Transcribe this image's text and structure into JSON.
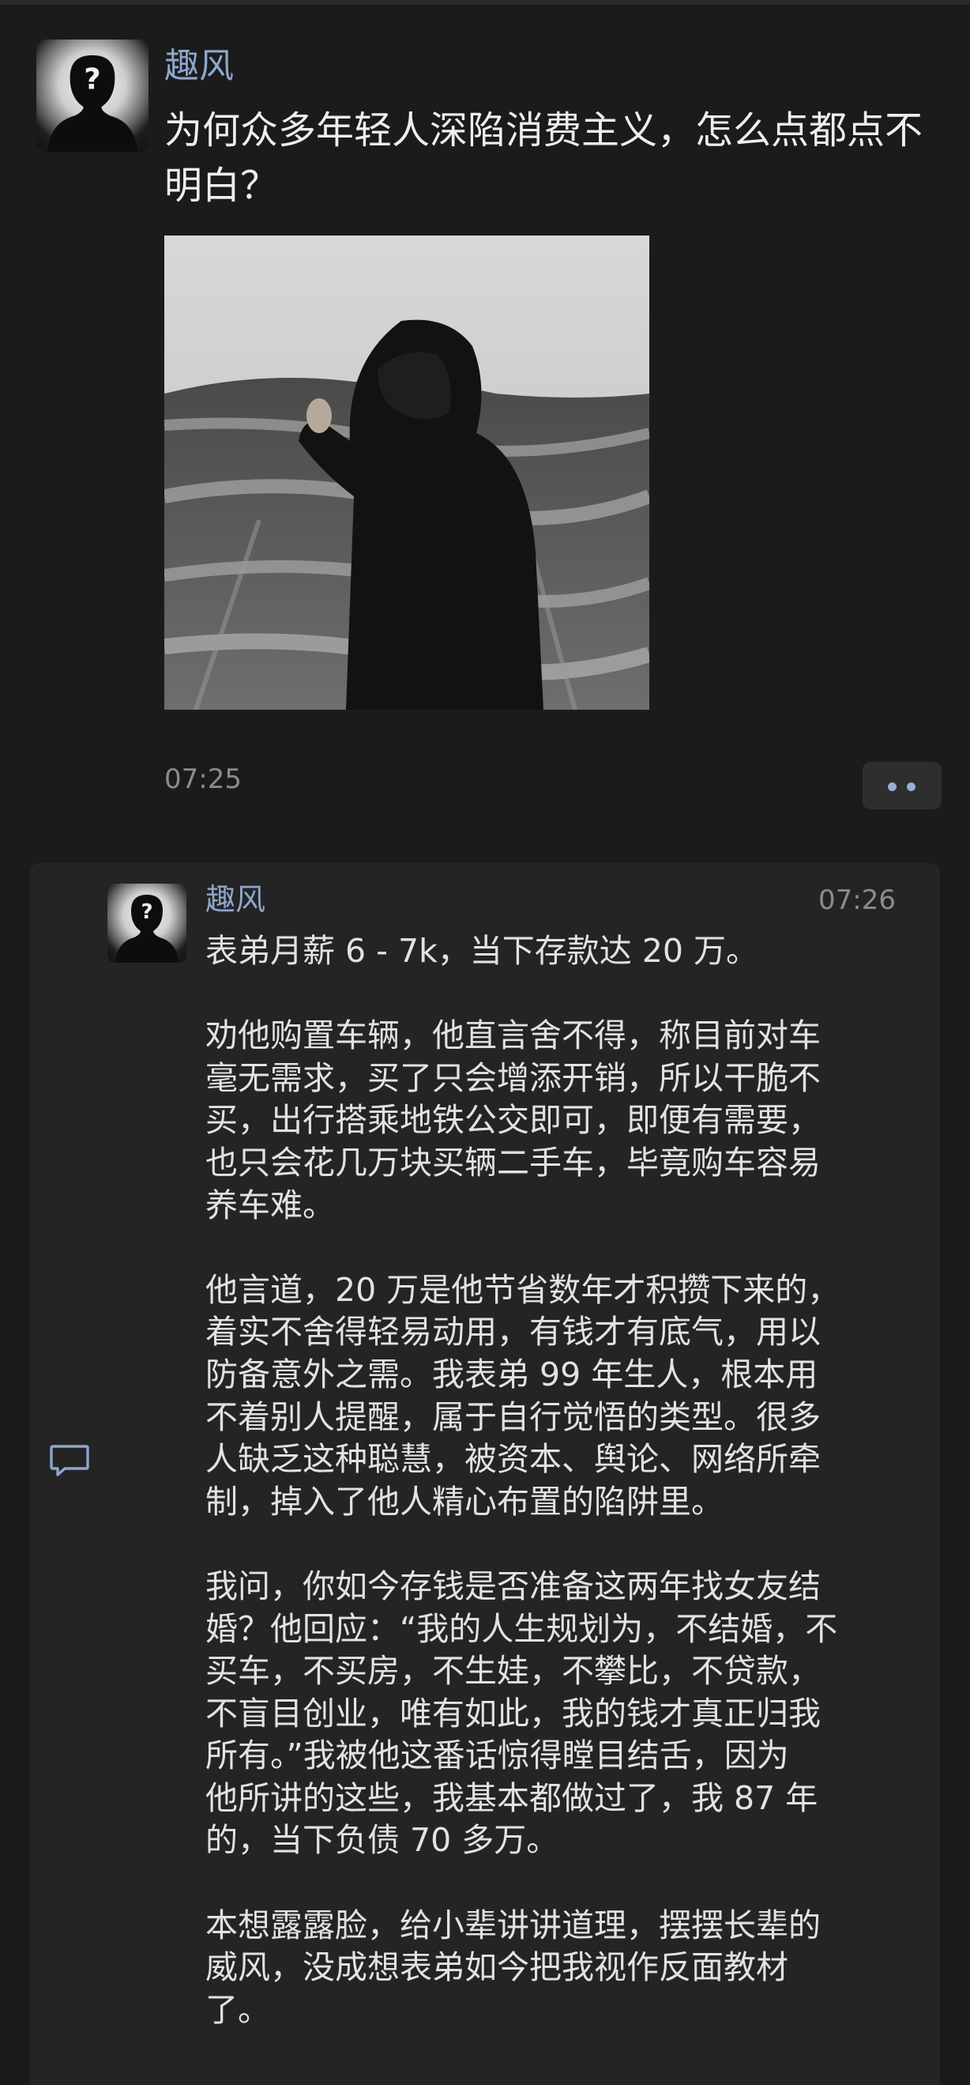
{
  "post": {
    "author": "趣风",
    "title": "为何众多年轻人深陷消费主义，怎么点都点不明白？",
    "time": "07:25",
    "more_icon": "more-dots-icon"
  },
  "comment": {
    "author": "趣风",
    "time": "07:26",
    "icon": "comment-bubble-icon",
    "paragraphs": [
      "表弟月薪 6 - 7k，当下存款达 20 万。",
      "劝他购置车辆，他直言舍不得，称目前对车\n毫无需求，买了只会增添开销，所以干脆不\n买，出行搭乘地铁公交即可，即便有需要，\n也只会花几万块买辆二手车，毕竟购车容易\n养车难。",
      "他言道，20 万是他节省数年才积攒下来的，\n着实不舍得轻易动用，有钱才有底气，用以\n防备意外之需。我表弟 99 年生人，根本用\n不着别人提醒，属于自行觉悟的类型。很多\n人缺乏这种聪慧，被资本、舆论、网络所牵\n制，掉入了他人精心布置的陷阱里。",
      "我问，你如今存钱是否准备这两年找女友结\n婚？他回应：“我的人生规划为，不结婚，不\n买车，不买房，不生娃，不攀比，不贷款，\n不盲目创业，唯有如此，我的钱才真正归我\n所有。”我被他这番话惊得瞠目结舌，因为\n他所讲的这些，我基本都做过了，我 87 年\n的，当下负债 70 多万。",
      "本想露露脸，给小辈讲讲道理，摆摆长辈的\n威风，没成想表弟如今把我视作反面教材\n了。"
    ]
  },
  "colors": {
    "background": "#1b1b1b",
    "card": "#242424",
    "author": "#8ea6cc",
    "muted": "#8c8c8c",
    "text": "#e2e2e2"
  }
}
